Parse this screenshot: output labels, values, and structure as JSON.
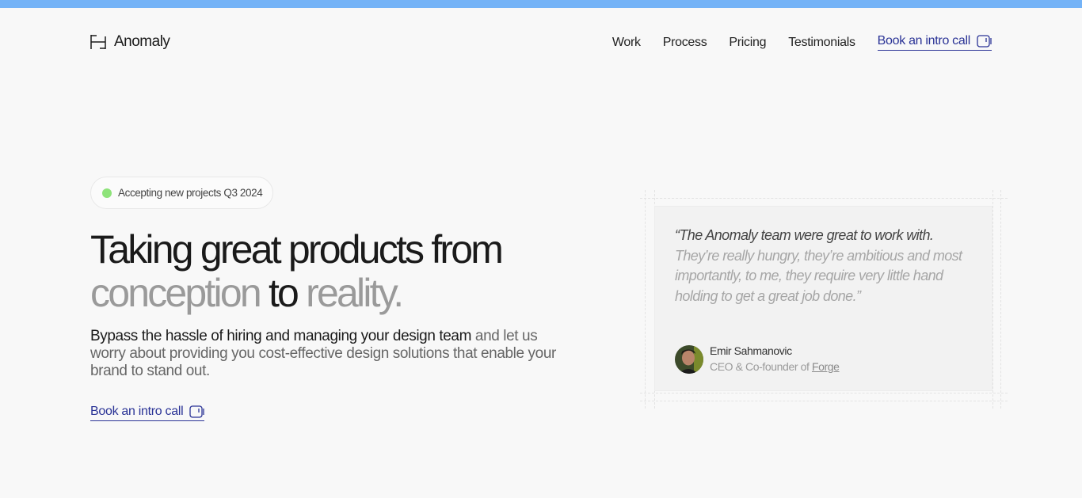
{
  "brand": {
    "name": "Anomaly",
    "logo_icon": "anomaly-logo-icon"
  },
  "nav": {
    "links": [
      "Work",
      "Process",
      "Pricing",
      "Testimonials"
    ],
    "cta_label": "Book an intro call",
    "cta_icon": "calendar-icon"
  },
  "hero": {
    "badge_text": "Accepting new projects Q3 2024",
    "title_line1": "Taking great products from",
    "title_word_conception": "conception",
    "title_word_to": "to",
    "title_word_reality": "reality.",
    "description_strong": "Bypass the hassle of hiring and managing your design team",
    "description_rest": "and let us worry about providing you cost-effective design solutions that enable your brand to stand out.",
    "cta_label": "Book an intro call"
  },
  "testimonial": {
    "quote_strong": "“The Anomaly team were great to work with.",
    "quote_rest": "They’re really hungry, they’re ambitious and most importantly, to me, they require very little hand holding to get a great job done.”",
    "author_name": "Emir Sahmanovic",
    "author_role_prefix": "CEO & Co-founder of",
    "author_company": "Forge"
  },
  "colors": {
    "accent": "#2a3396",
    "top_bar": "#74b3f7",
    "badge_dot": "#8ee37a",
    "background": "#f8f8f8"
  }
}
